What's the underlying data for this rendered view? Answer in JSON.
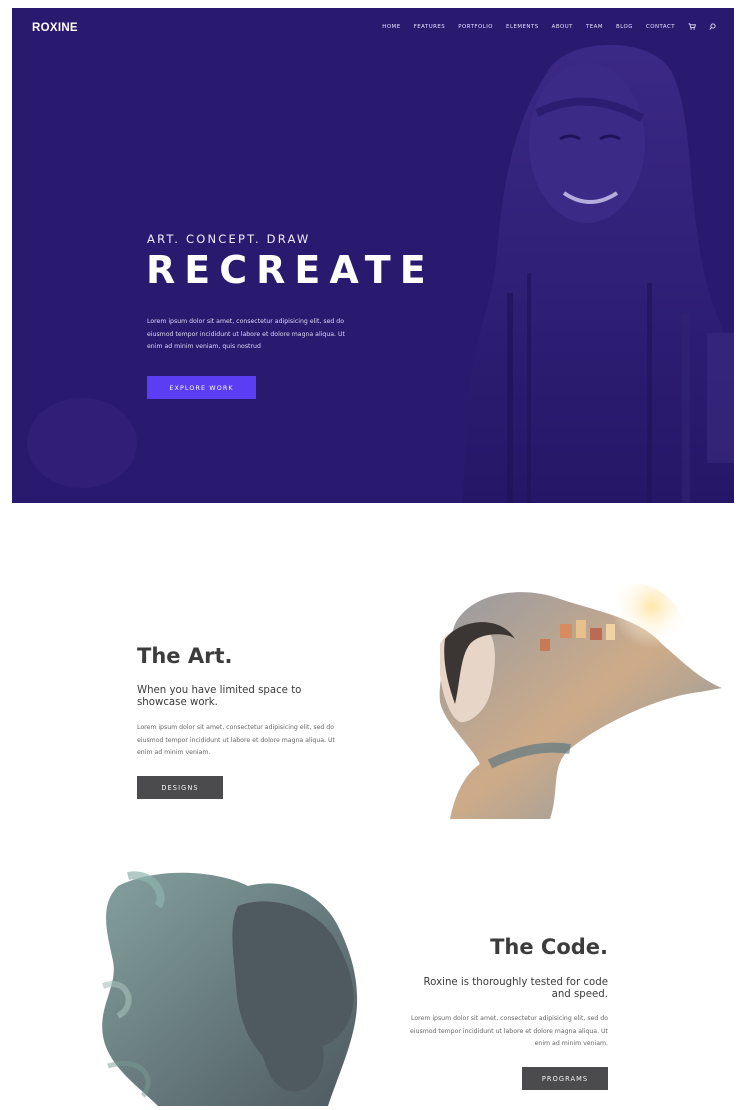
{
  "site": {
    "logo": "ROXINE"
  },
  "nav": {
    "items": [
      "HOME",
      "FEATURES",
      "PORTFOLIO",
      "ELEMENTS",
      "ABOUT",
      "TEAM",
      "BLOG",
      "CONTACT"
    ],
    "icons": [
      "cart-icon",
      "search-icon"
    ]
  },
  "hero": {
    "eyebrow": "ART. CONCEPT. DRAW",
    "headline": "RECREATE",
    "body": "Lorem ipsum dolor sit amet, consectetur adipisicing elit, sed do eiusmod tempor incididunt ut labore et dolore magna aliqua. Ut enim ad minim veniam, quis nostrud",
    "button": "EXPLORE WORK",
    "colors": {
      "background": "#2a1a6f",
      "button": "#5b3df4"
    }
  },
  "art": {
    "title": "The Art.",
    "subtitle": "When you have limited space to showcase work.",
    "body": "Lorem ipsum dolor sit amet, consectetur adipisicing elit, sed do eiusmod tempor incididunt ut labore et dolore magna aliqua. Ut enim ad minim veniam.",
    "button": "DESIGNS"
  },
  "code": {
    "title": "The Code.",
    "subtitle": "Roxine is thoroughly tested for code and speed.",
    "body": "Lorem ipsum dolor sit amet, consectetur adipisicing elit, sed do eiusmod tempor incididunt ut labore et dolore magna aliqua. Ut enim ad minim veniam.",
    "button": "PROGRAMS"
  }
}
